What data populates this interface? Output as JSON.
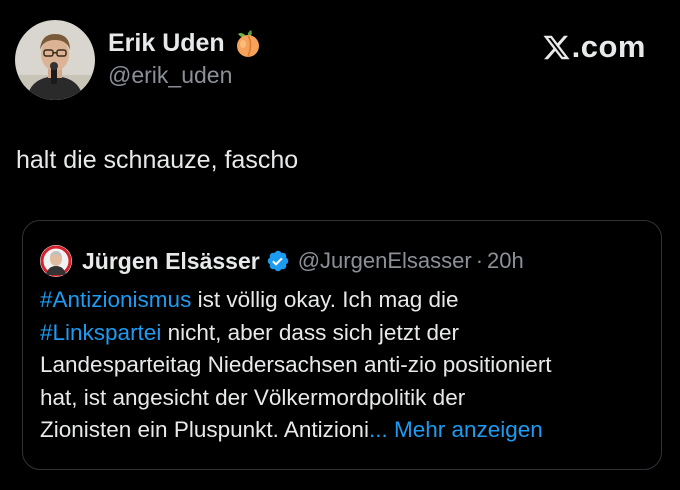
{
  "author": {
    "display_name": "Erik Uden",
    "handle": "@erik_uden",
    "badge_icon": "peach-icon"
  },
  "brand": {
    "x_icon": "x-logo-icon",
    "suffix": ".com"
  },
  "tweet": {
    "text": "halt die schnauze, fascho"
  },
  "quoted": {
    "display_name": "Jürgen Elsässer",
    "verified_icon": "verified-badge-icon",
    "handle": "@JurgenElsasser",
    "separator": "·",
    "time": "20h",
    "hashtag1": "#Antizionismus",
    "text1": " ist völlig okay. Ich mag die",
    "hashtag2": "#Linkspartei",
    "text2": " nicht, aber dass sich jetzt der",
    "line3": "Landesparteitag Niedersachsen anti-zio positioniert",
    "line4": "hat, ist angesicht der Völkermordpolitik der",
    "line5": "Zionisten ein Pluspunkt. Antizioni",
    "show_more": "... Mehr anzeigen"
  },
  "colors": {
    "background": "#000000",
    "text_primary": "#e7e9ea",
    "text_secondary": "#8b9097",
    "link": "#1d9bf0",
    "verified": "#1d9bf0",
    "border": "#2f3336"
  }
}
